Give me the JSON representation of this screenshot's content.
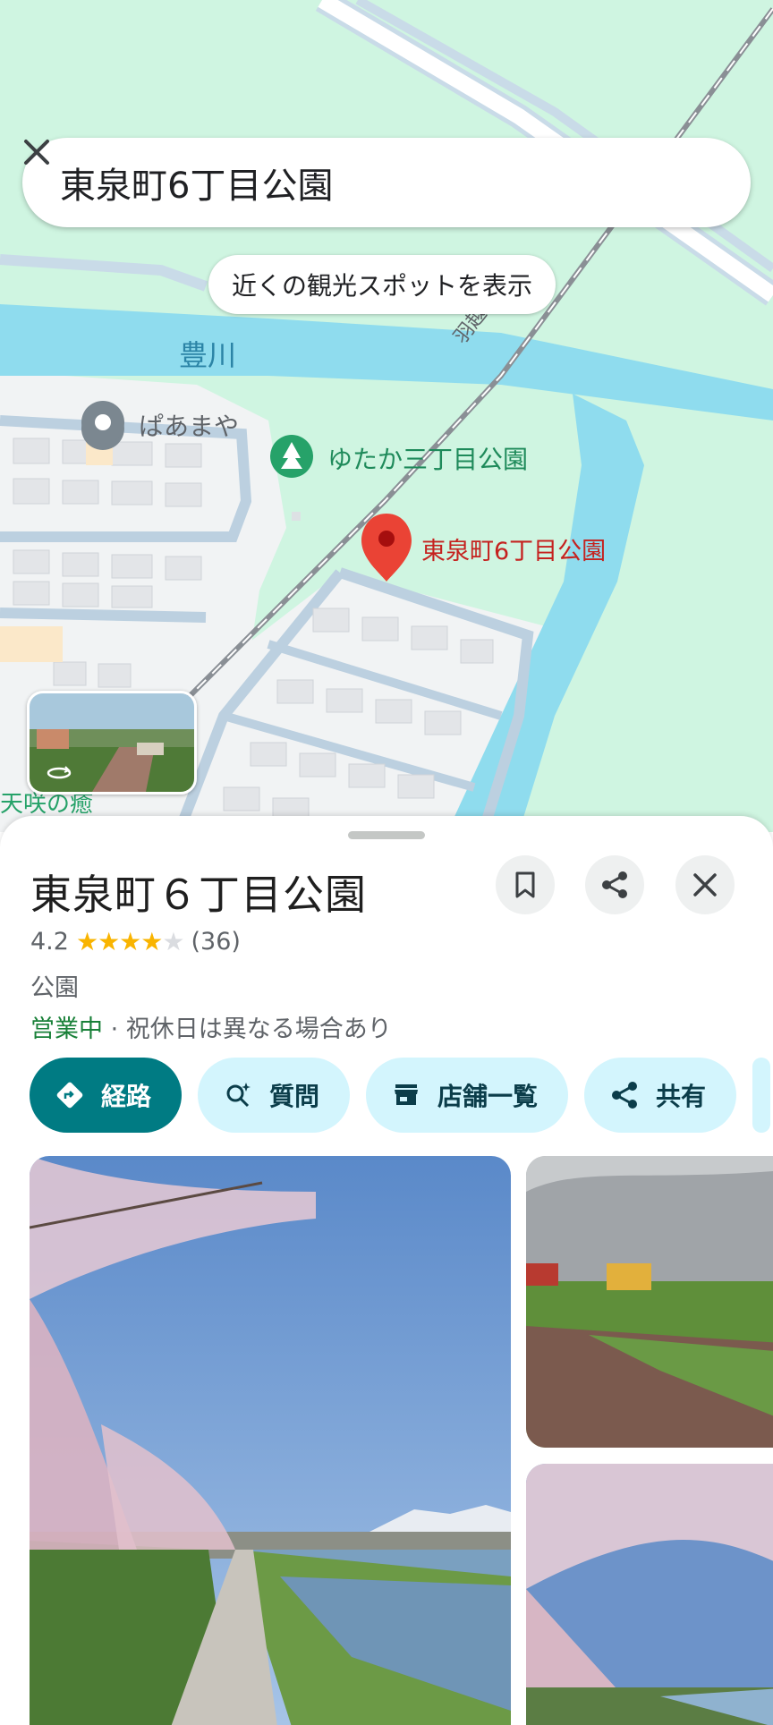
{
  "search": {
    "query": "東泉町6丁目公園"
  },
  "map": {
    "nearby_chip": "近くの観光スポットを表示",
    "river_label": "豊川",
    "rail_label": "羽越本線",
    "poi_papamaya": "ぱあまや",
    "poi_yutaka_park": "ゆたか三丁目公園",
    "pin_label": "東泉町6丁目公園",
    "partial_label": "天咲の癒"
  },
  "place": {
    "title": "東泉町６丁目公園",
    "rating": "4.2",
    "stars_filled": 4,
    "review_count": "(36)",
    "category": "公園",
    "status_open": "営業中",
    "status_note": " · 祝休日は異なる場合あり"
  },
  "actions": {
    "directions": "経路",
    "ask": "質問",
    "stores": "店舗一覧",
    "share": "共有"
  },
  "colors": {
    "map_green": "#cff5e1",
    "river": "#8fdcee",
    "primary": "#007b83",
    "chip": "#d3f5fd",
    "pin": "#e53935",
    "open_green": "#188038"
  }
}
